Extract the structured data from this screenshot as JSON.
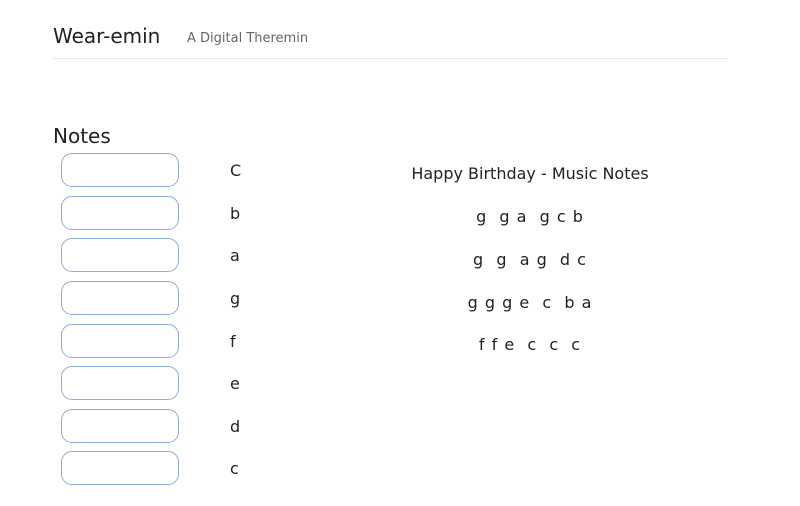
{
  "header": {
    "title": "Wear-emin",
    "subtitle": "A Digital Theremin"
  },
  "notes_section": {
    "title": "Notes",
    "items": [
      {
        "label": "C",
        "value": ""
      },
      {
        "label": "b",
        "value": ""
      },
      {
        "label": "a",
        "value": ""
      },
      {
        "label": "g",
        "value": ""
      },
      {
        "label": "f",
        "value": ""
      },
      {
        "label": "e",
        "value": ""
      },
      {
        "label": "d",
        "value": ""
      },
      {
        "label": "c",
        "value": ""
      }
    ]
  },
  "song": {
    "title": "Happy Birthday - Music Notes",
    "lines": [
      "g  g a  g c b",
      "g  g  a g  d c",
      "g g g e  c  b a",
      "f f e  c  c  c"
    ]
  }
}
